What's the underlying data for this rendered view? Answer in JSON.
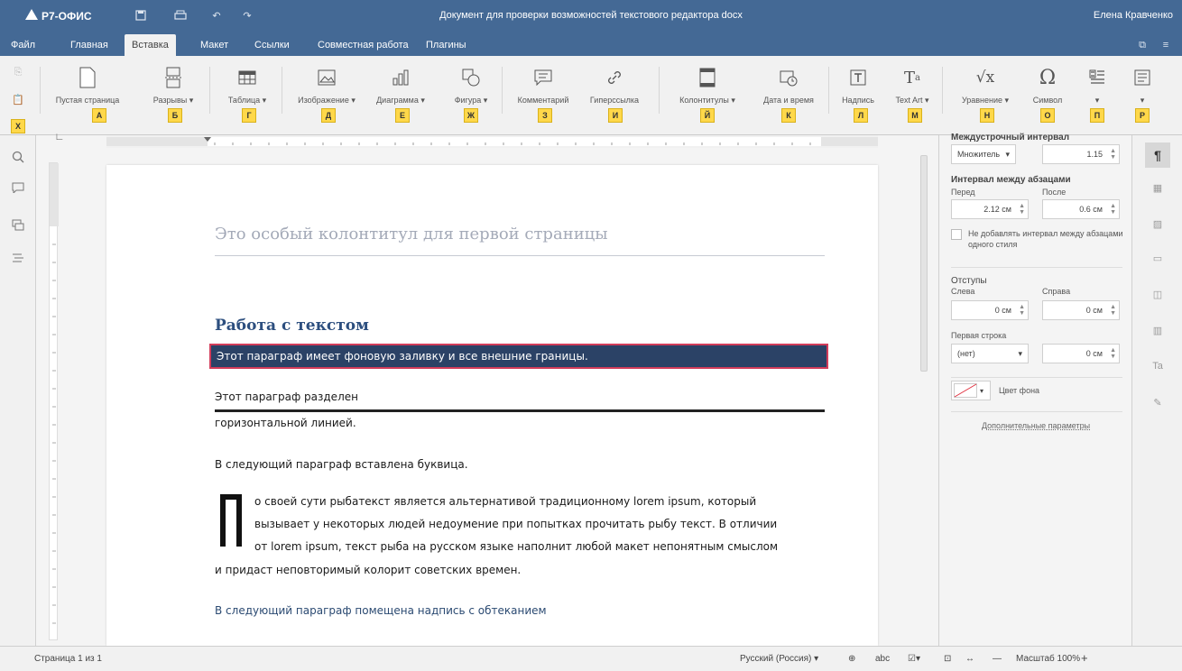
{
  "app": {
    "name": "Р7-ОФИС"
  },
  "title_bar": {
    "document_title": "Документ для проверки возможностей текстового редактора docx",
    "user_name": "Елена Кравченко"
  },
  "menu_tabs": [
    {
      "label": "Файл"
    },
    {
      "label": "Главная"
    },
    {
      "label": "Вставка"
    },
    {
      "label": "Макет"
    },
    {
      "label": "Ссылки"
    },
    {
      "label": "Совместная работа"
    },
    {
      "label": "Плагины"
    }
  ],
  "active_tab": "Вставка",
  "toolbar": {
    "buttons": [
      {
        "label": "Пустая страница",
        "key": "А"
      },
      {
        "label": "Разрывы ▾",
        "key": "Б"
      },
      {
        "label": "Таблица ▾",
        "key": "Г"
      },
      {
        "label": "Изображение ▾",
        "key": "Д"
      },
      {
        "label": "Диаграмма ▾",
        "key": "Е"
      },
      {
        "label": "Фигура ▾",
        "key": "Ж"
      },
      {
        "label": "Комментарий",
        "key": "З"
      },
      {
        "label": "Гиперссылка",
        "key": "И"
      },
      {
        "label": "Колонтитулы ▾",
        "key": "Й"
      },
      {
        "label": "Дата и время",
        "key": "К"
      },
      {
        "label": "Надпись",
        "key": "Л"
      },
      {
        "label": "Text Art ▾",
        "key": "М"
      },
      {
        "label": "Уравнение ▾",
        "key": "Н"
      },
      {
        "label": "Символ",
        "key": "О"
      },
      {
        "label": "▾",
        "key": "П"
      },
      {
        "label": "▾",
        "key": "Р"
      }
    ],
    "left_key": "Х"
  },
  "document": {
    "header_text": "Это особый колонтитул для первой страницы",
    "heading": "Работа с текстом",
    "shaded_paragraph": "Этот параграф имеет фоновую заливку и все внешние границы.",
    "hr_paragraph_1": "Этот параграф разделен",
    "hr_paragraph_2": "горизонтальной линией.",
    "dropcap_intro": "В следующий параграф вставлена буквица.",
    "dropcap_letter": "П",
    "dropcap_line_1": "о своей сути рыбатекст является альтернативой традиционному lorem ipsum, который",
    "dropcap_line_2": "вызывает у некоторых людей недоумение при попытках прочитать рыбу текст. В отличии",
    "dropcap_line_3": "от lorem ipsum, текст рыба на русском языке наполнит любой макет непонятным смыслом",
    "dropcap_line_4": "и придаст неповторимый колорит советских времен.",
    "textbox_intro": "В следующий параграф помещена надпись с обтеканием"
  },
  "paragraph_settings": {
    "line_spacing_title": "Междустрочный интервал",
    "line_spacing_type": "Множитель",
    "line_spacing_value": "1.15",
    "para_spacing_title": "Интервал между абзацами",
    "before_label": "Перед",
    "after_label": "После",
    "before_value": "2.12 см",
    "after_value": "0.6 см",
    "no_spacing_checkbox": "Не добавлять интервал между абзацами одного стиля",
    "indents_title": "Отступы",
    "left_label": "Слева",
    "right_label": "Справа",
    "left_value": "0 см",
    "right_value": "0 см",
    "first_line_label": "Первая строка",
    "first_line_type": "(нет)",
    "first_line_value": "0 см",
    "bg_color_label": "Цвет фона",
    "advanced_link": "Дополнительные параметры"
  },
  "status_bar": {
    "page_info": "Страница 1 из 1",
    "language": "Русский (Россия)",
    "zoom": "Масштаб 100%"
  },
  "colors": {
    "brand": "#446995",
    "heading": "#2d4f7f",
    "shaded_bg": "#2b4266",
    "shaded_border": "#d23c5a",
    "key_tip": "#ffd84a"
  }
}
